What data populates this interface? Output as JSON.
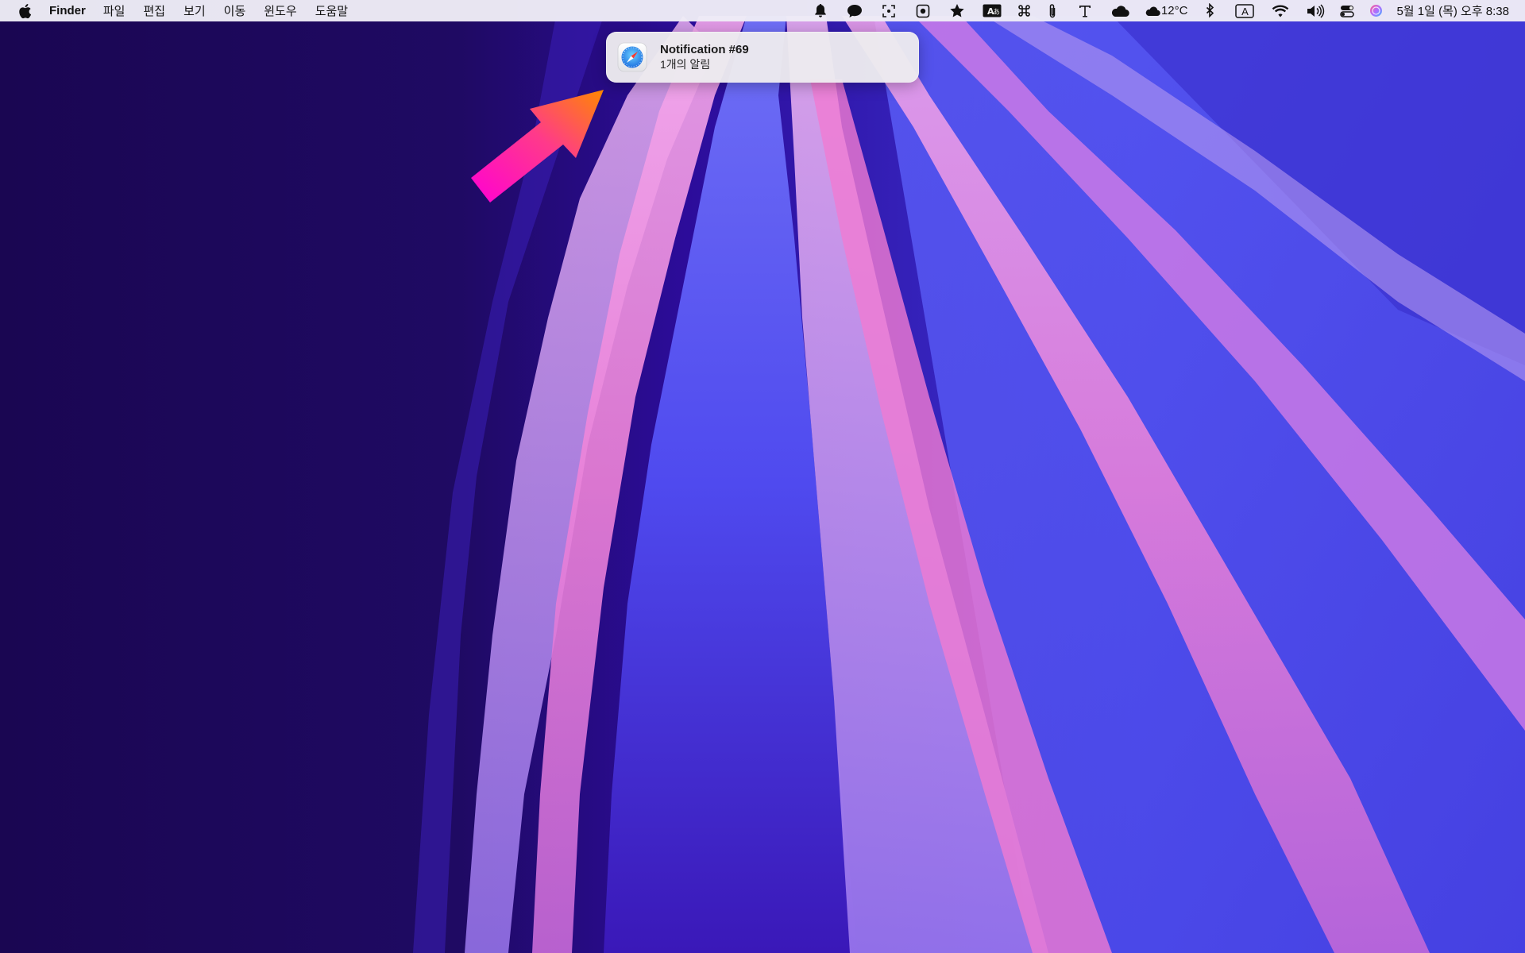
{
  "menubar": {
    "app_name": "Finder",
    "menus": [
      "파일",
      "편집",
      "보기",
      "이동",
      "윈도우",
      "도움말"
    ],
    "status_icons": [
      "notification-bell-icon",
      "messages-icon",
      "screen-capture-icon",
      "screen-recording-icon",
      "star-icon",
      "translate-icon",
      "command-key-icon",
      "paperclip-icon",
      "text-tool-icon",
      "cloud-icon",
      "weather-icon",
      "bluetooth-icon",
      "input-source-icon",
      "wifi-icon",
      "volume-icon",
      "control-center-icon",
      "siri-icon"
    ],
    "weather": "12°C",
    "input_source": "A",
    "clock": "5월 1일 (목) 오후 8:38"
  },
  "notification": {
    "app_icon": "safari-compass-icon",
    "title": "Notification #69",
    "body": "1개의 알림"
  },
  "annotation": {
    "arrow_icon": "pointer-arrow",
    "colors": {
      "start": "#ff00d4",
      "end": "#ff8800"
    }
  },
  "colors": {
    "desktop_dark": "#1b0857",
    "wallpaper_blue": "#4a3df2",
    "wallpaper_pink": "#ef7fd6",
    "menubar_bg": "#eeecf6"
  }
}
